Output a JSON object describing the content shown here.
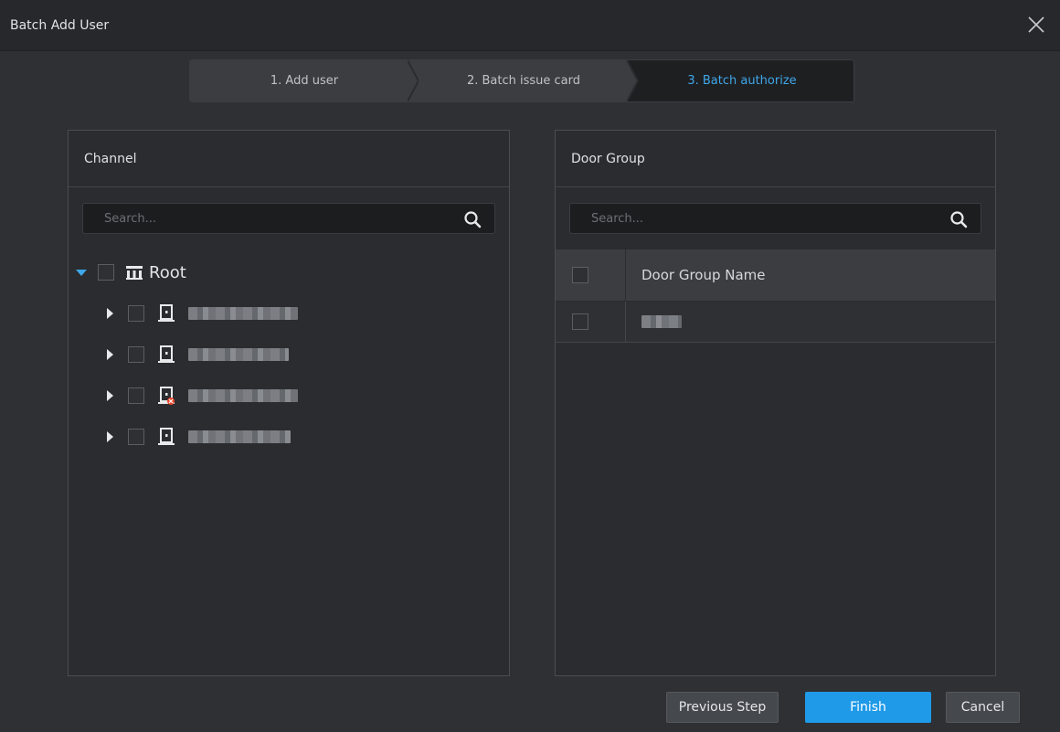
{
  "window": {
    "title": "Batch Add User"
  },
  "steps": [
    {
      "label": "1. Add user",
      "state": "done"
    },
    {
      "label": "2. Batch issue card",
      "state": "done"
    },
    {
      "label": "3. Batch authorize",
      "state": "active"
    }
  ],
  "channel_panel": {
    "header": "Channel",
    "search_placeholder": "Search...",
    "tree": {
      "root": {
        "label": "Root",
        "expanded": true,
        "checked": false,
        "icon": "building-icon"
      },
      "children": [
        {
          "label_blurred": true,
          "icon": "door-icon",
          "status": "online",
          "expanded": false,
          "checked": false
        },
        {
          "label_blurred": true,
          "icon": "door-icon",
          "status": "online",
          "expanded": false,
          "checked": false
        },
        {
          "label_blurred": true,
          "icon": "door-offline-icon",
          "status": "offline",
          "expanded": false,
          "checked": false
        },
        {
          "label_blurred": true,
          "icon": "door-icon",
          "status": "online",
          "expanded": false,
          "checked": false
        }
      ]
    }
  },
  "door_group_panel": {
    "header": "Door Group",
    "search_placeholder": "Search...",
    "table": {
      "columns": [
        "Door Group Name"
      ],
      "rows": [
        {
          "name_blurred": true,
          "checked": false
        }
      ]
    }
  },
  "footer": {
    "previous_label": "Previous Step",
    "finish_label": "Finish",
    "cancel_label": "Cancel"
  },
  "colors": {
    "accent": "#1f9ae8",
    "active_step_text": "#3fa7ea",
    "offline_badge": "#e8472c",
    "background": "#2e3033"
  }
}
